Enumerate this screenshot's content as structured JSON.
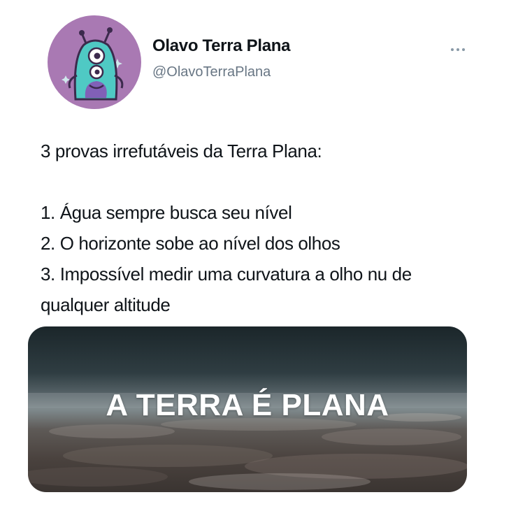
{
  "author": {
    "display_name": "Olavo Terra Plana",
    "handle": "@OlavoTerraPlana",
    "avatar_icon": "alien-monster-icon",
    "avatar_bg": "#a979b3"
  },
  "more_icon": "more-dots-icon",
  "tweet": {
    "lines": [
      "3 provas irrefutáveis da Terra Plana:",
      "1. Água sempre busca seu nível",
      "2. O horizonte sobe ao nível dos olhos",
      "3. Impossível medir uma curvatura a olho nu de",
      "qualquer altitude"
    ]
  },
  "media": {
    "caption": "A TERRA É PLANA",
    "description_icon": "earth-surface-photo"
  }
}
